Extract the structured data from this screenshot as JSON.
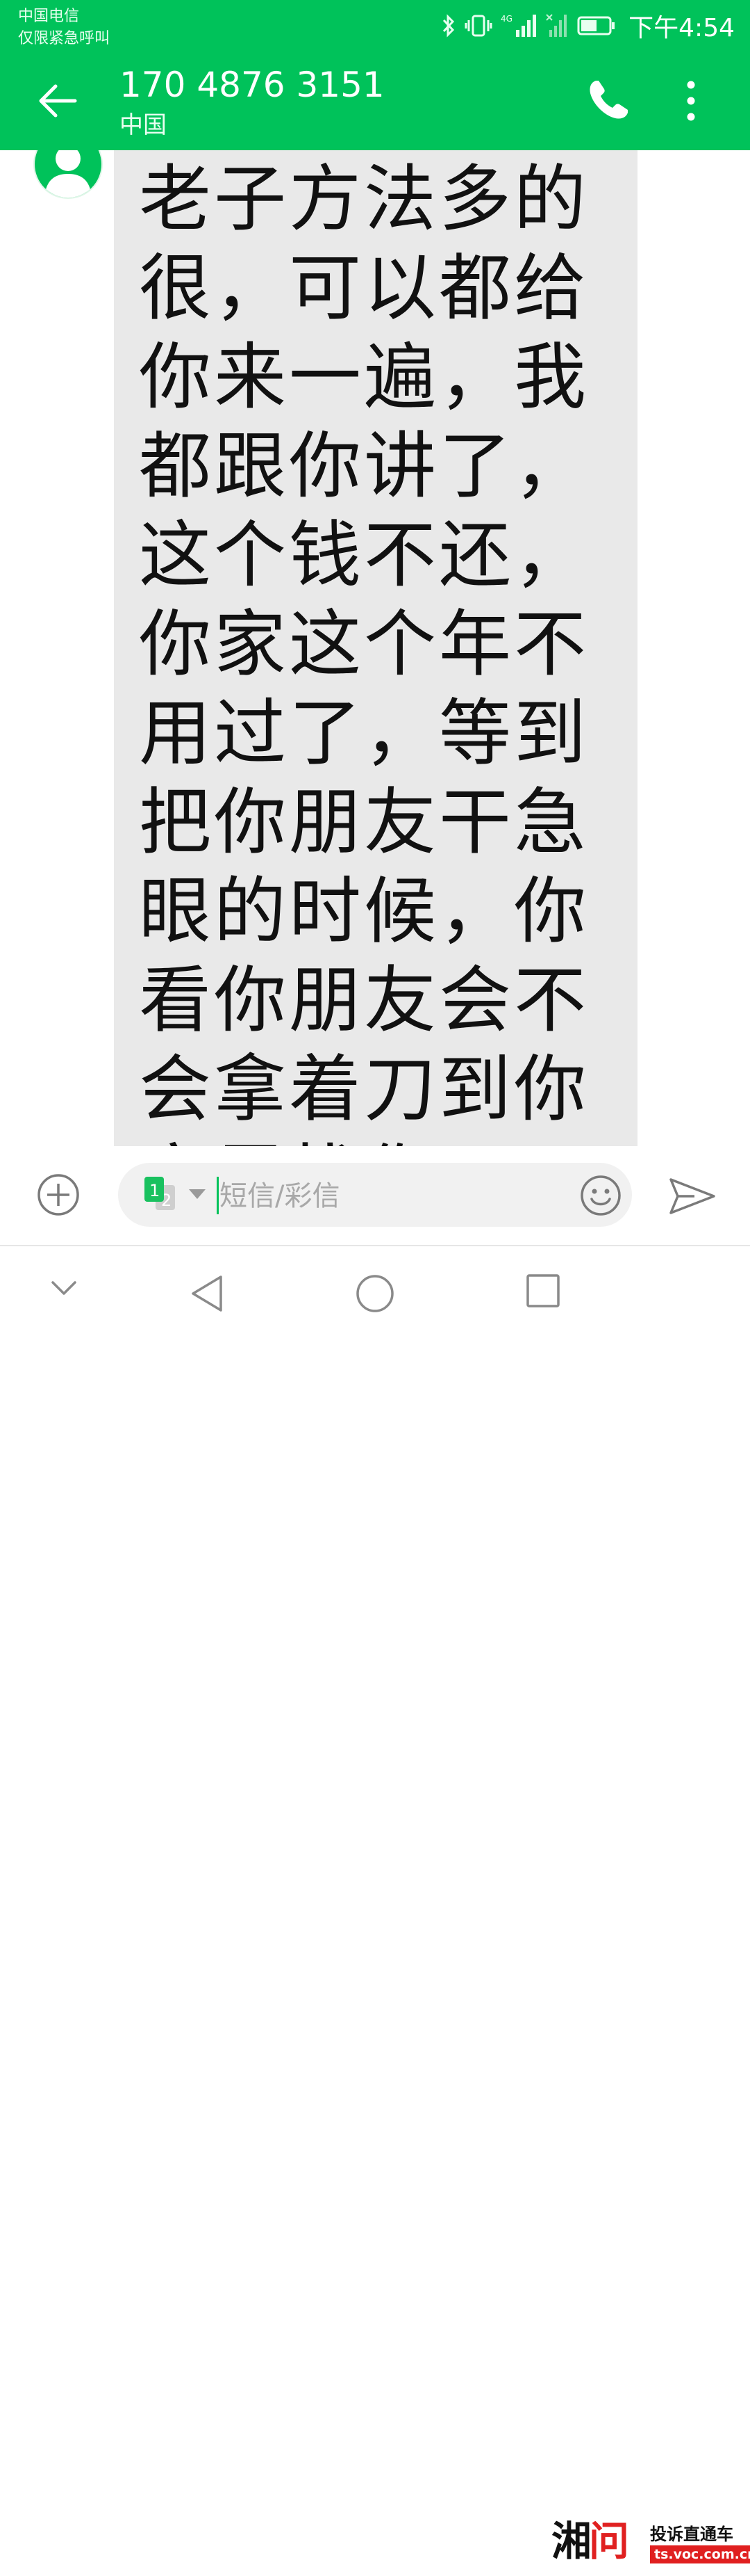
{
  "status_bar": {
    "carrier": "中国电信",
    "emergency": "仅限紧急呼叫",
    "network": "4G",
    "time": "下午4:54"
  },
  "header": {
    "title": "170 4876 3151",
    "subtitle": "中国"
  },
  "message": {
    "text": "老子方法多的很，可以都给你来一遍，我都跟你讲了，这个钱不还，你家这个年不用过了，等到把你朋友干急眼的时候，你看你朋友会不会拿着刀到你家里找你"
  },
  "composer": {
    "placeholder": "短信/彩信",
    "sim_primary": "1",
    "sim_secondary": "2"
  },
  "watermark": {
    "logo_left": "湘",
    "logo_right": "问",
    "slogan": "投诉直通车",
    "url": "ts.voc.com.cn"
  },
  "colors": {
    "accent": "#00c25a",
    "bubble": "#e9e9e9",
    "watermark_red": "#e02020"
  },
  "icons": {
    "back": "arrow-left-icon",
    "call": "phone-icon",
    "more": "more-vertical-icon",
    "add": "plus-circle-icon",
    "emoji": "smiley-icon",
    "send": "send-icon"
  }
}
